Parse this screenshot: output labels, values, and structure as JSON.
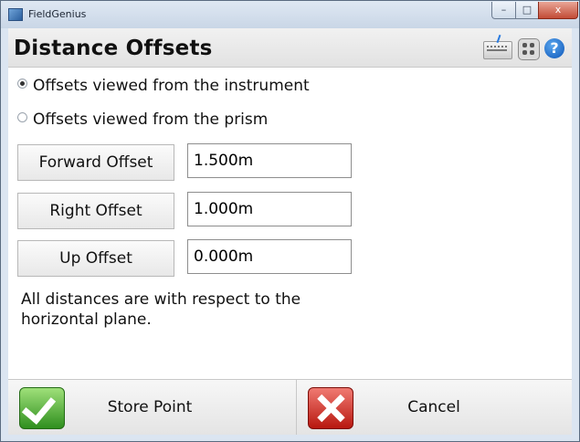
{
  "window": {
    "title": "FieldGenius",
    "controls": {
      "minimize": "–",
      "maximize": "□",
      "close": "x"
    }
  },
  "header": {
    "title": "Distance Offsets",
    "icons": [
      "keyboard-icon",
      "grid-icon",
      "help-icon"
    ],
    "help_glyph": "?"
  },
  "options": {
    "selected": "instrument",
    "items": [
      {
        "id": "instrument",
        "label": "Offsets viewed from the instrument"
      },
      {
        "id": "prism",
        "label": "Offsets viewed from the prism"
      }
    ]
  },
  "offsets": {
    "forward": {
      "label": "Forward Offset",
      "value": "1.500m"
    },
    "right": {
      "label": "Right Offset",
      "value": "1.000m"
    },
    "up": {
      "label": "Up Offset",
      "value": "0.000m"
    }
  },
  "note": "All distances are with respect to the horizontal plane.",
  "footer": {
    "store_label": "Store Point",
    "cancel_label": "Cancel"
  },
  "colors": {
    "titlebar": "#c9d6e6",
    "help_blue": "#0d55b8",
    "check_green": "#2f8f1e",
    "cancel_red": "#b8170f"
  }
}
